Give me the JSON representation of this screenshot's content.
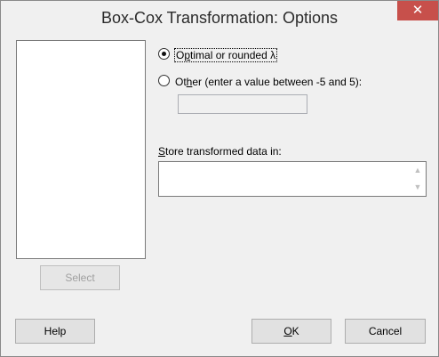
{
  "window": {
    "title": "Box-Cox Transformation: Options",
    "close_symbol": "✕"
  },
  "variables_list": {
    "items": []
  },
  "select_button": {
    "label": "Select"
  },
  "lambda": {
    "option_optimal": {
      "prefix": "O",
      "accel": "p",
      "rest": "timal or rounded λ",
      "selected": true
    },
    "option_other": {
      "prefix": "Ot",
      "accel": "h",
      "rest": "er (enter a value between -5 and 5):",
      "selected": false
    },
    "other_value": ""
  },
  "store": {
    "label_accel": "S",
    "label_rest": "tore transformed data in:",
    "value": ""
  },
  "buttons": {
    "help": "Help",
    "ok_accel": "O",
    "ok_rest": "K",
    "cancel": "Cancel"
  },
  "icons": {
    "scroll_up": "▲",
    "scroll_down": "▼"
  }
}
